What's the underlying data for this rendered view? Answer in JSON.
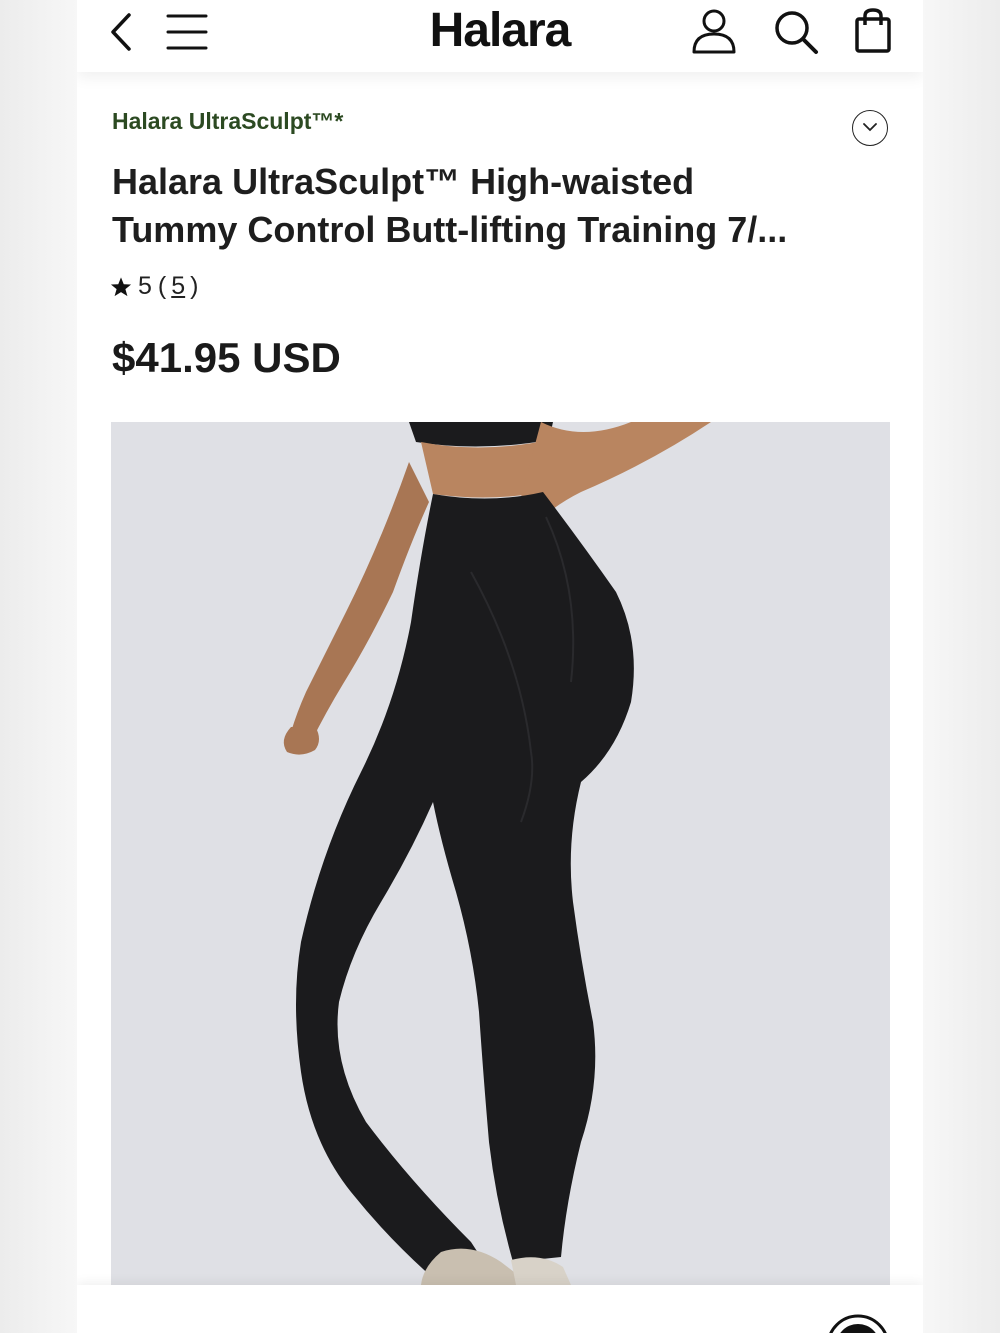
{
  "header": {
    "brand": "Halara",
    "icons": [
      "back-chevron-icon",
      "menu-icon",
      "account-icon",
      "search-icon",
      "shopping-bag-icon"
    ]
  },
  "product": {
    "collection": "Halara UltraSculpt™*",
    "title_line1": "Halara UltraSculpt™ High-waisted",
    "title_line2": "Tummy Control Butt-lifting Training 7/...",
    "rating_value": "5",
    "rating_open": "(",
    "rating_count": "5",
    "rating_close": ")",
    "price": "$41.95 USD"
  },
  "colors": {
    "collection_text": "#2c4a22",
    "image_background": "#dfe0e5",
    "leggings": "#1b1b1d",
    "skin": "#b98560"
  }
}
